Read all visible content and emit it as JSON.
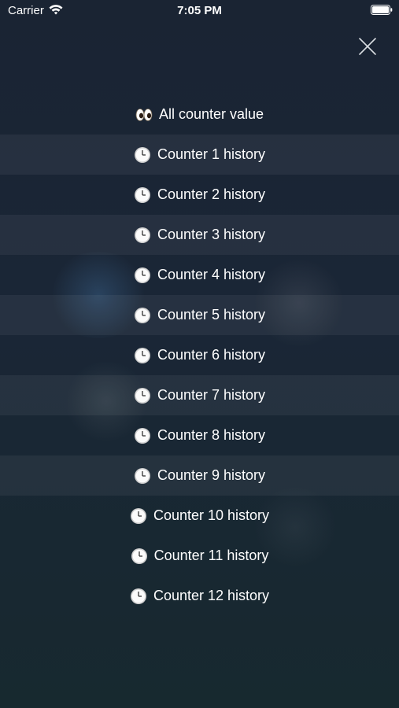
{
  "status_bar": {
    "carrier": "Carrier",
    "time": "7:05 PM"
  },
  "close_icon": "close-x-icon",
  "menu": {
    "all_counter": {
      "label": "All counter value",
      "icon": "eyes-icon"
    },
    "items": [
      {
        "label": "Counter 1 history",
        "icon": "clock-icon"
      },
      {
        "label": "Counter 2 history",
        "icon": "clock-icon"
      },
      {
        "label": "Counter 3 history",
        "icon": "clock-icon"
      },
      {
        "label": "Counter 4 history",
        "icon": "clock-icon"
      },
      {
        "label": "Counter 5 history",
        "icon": "clock-icon"
      },
      {
        "label": "Counter 6 history",
        "icon": "clock-icon"
      },
      {
        "label": "Counter 7 history",
        "icon": "clock-icon"
      },
      {
        "label": "Counter 8 history",
        "icon": "clock-icon"
      },
      {
        "label": "Counter 9 history",
        "icon": "clock-icon"
      },
      {
        "label": "Counter 10 history",
        "icon": "clock-icon"
      },
      {
        "label": "Counter 11 history",
        "icon": "clock-icon"
      },
      {
        "label": "Counter 12 history",
        "icon": "clock-icon"
      }
    ]
  },
  "colors": {
    "background_top": "#1a2433",
    "background_bottom": "#17292f",
    "text": "#ffffff"
  }
}
